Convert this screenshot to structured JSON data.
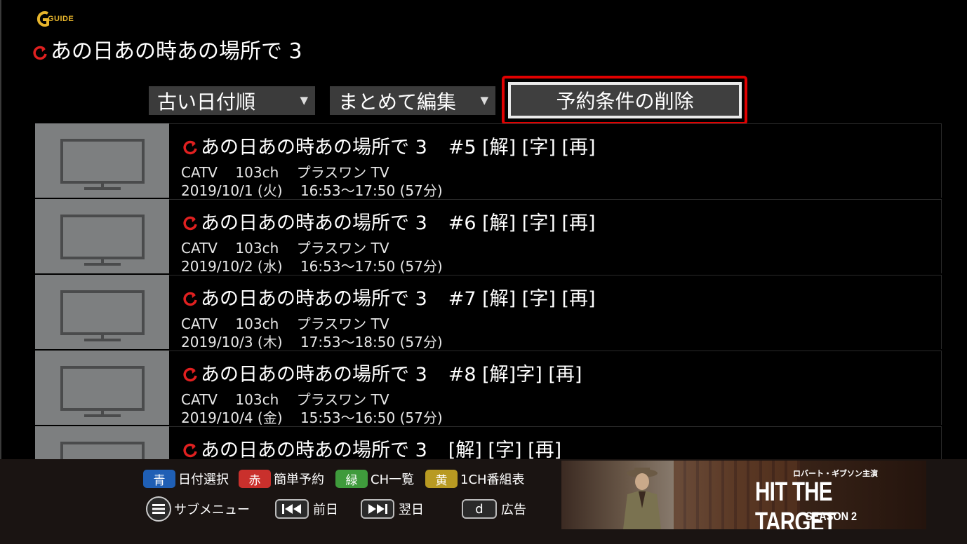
{
  "logo": {
    "text": "GUIDE"
  },
  "series_title": "あの日あの時あの場所で 3",
  "controls": {
    "sort_label": "古い日付順",
    "bulk_label": "まとめて編集",
    "delete_label": "予約条件の削除",
    "arrow": "▼"
  },
  "programs": [
    {
      "title": "あの日あの時あの場所で 3",
      "episode": "#5 [解] [字] [再]",
      "channel": "CATV    103ch    プラスワン TV",
      "datetime": "2019/10/1 (火)    16:53〜17:50 (57分)"
    },
    {
      "title": "あの日あの時あの場所で 3",
      "episode": "#6 [解] [字] [再]",
      "channel": "CATV    103ch    プラスワン TV",
      "datetime": "2019/10/2 (水)    16:53〜17:50 (57分)"
    },
    {
      "title": "あの日あの時あの場所で 3",
      "episode": "#7 [解] [字] [再]",
      "channel": "CATV    103ch    プラスワン TV",
      "datetime": "2019/10/3 (木)    17:53〜18:50 (57分)"
    },
    {
      "title": "あの日あの時あの場所で 3",
      "episode": "#8 [解]字] [再]",
      "channel": "CATV    103ch    プラスワン TV",
      "datetime": "2019/10/4 (金)    15:53〜16:50 (57分)"
    },
    {
      "title": "あの日あの時あの場所で 3",
      "episode": "[解] [字] [再]",
      "channel": "",
      "datetime": ""
    }
  ],
  "footer": {
    "blue": {
      "key": "青",
      "label": "日付選択"
    },
    "red": {
      "key": "赤",
      "label": "簡単予約"
    },
    "green": {
      "key": "緑",
      "label": "CH一覧"
    },
    "yellow": {
      "key": "黄",
      "label": "1CH番組表"
    },
    "submenu_label": "サブメニュー",
    "prev_label": "前日",
    "next_label": "翌日",
    "d_key": "d",
    "ad_label": "広告"
  },
  "ad_banner": {
    "subtitle": "ロバート・ギブソン主演",
    "title": "HIT THE TARGET",
    "season": "SEASON 2"
  },
  "colors": {
    "accent_red": "#e00000",
    "blue": "#1f5fb5",
    "red": "#c9302c",
    "green": "#3f9b3c",
    "yellow": "#b89a22"
  }
}
